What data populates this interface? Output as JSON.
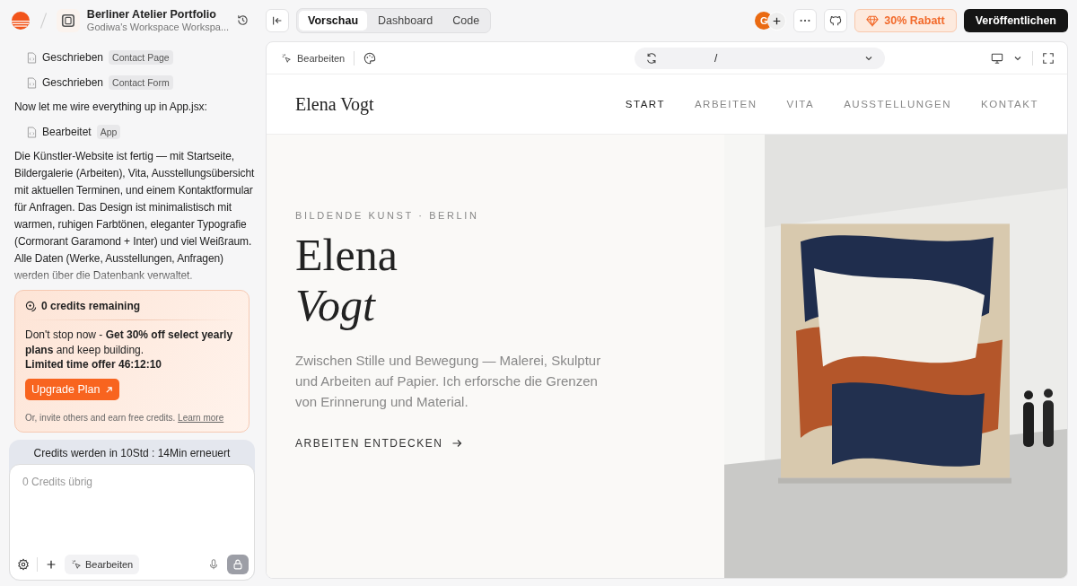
{
  "project": {
    "title": "Berliner Atelier Portfolio",
    "subtitle": "Godiwa's Workspace Workspa..."
  },
  "chat": [
    {
      "kind": "action",
      "verb": "Geschrieben",
      "tag": "Contact Page"
    },
    {
      "kind": "action",
      "verb": "Geschrieben",
      "tag": "Contact Form"
    },
    {
      "kind": "text",
      "text": "Now let me wire everything up in App.jsx:"
    },
    {
      "kind": "action",
      "verb": "Bearbeitet",
      "tag": "App"
    },
    {
      "kind": "text",
      "text": "Die Künstler-Website ist fertig — mit Startseite, Bildergalerie (Arbeiten), Vita, Ausstellungsübersicht mit aktuellen Terminen, und einem Kontaktformular für Anfragen. Das Design ist minimalistisch mit warmen, ruhigen Farbtönen, eleganter Typografie (Cormorant Garamond + Inter) und viel Weißraum. Alle Daten (Werke, Ausstellungen, Anfragen) werden über die Datenbank verwaltet."
    }
  ],
  "credits_card": {
    "title": "0 credits remaining",
    "message": "Don't stop now - **Get 30% off select yearly plans** and keep building.",
    "offer": "Limited time offer 46:12:10",
    "button": "Upgrade Plan",
    "footer": "Or, invite others and earn free credits.",
    "link": "Learn more"
  },
  "renewal": "Credits werden in 10Std : 14Min erneuert",
  "composer": {
    "placeholder": "0 Credits übrig",
    "mode": "Bearbeiten"
  },
  "tabs": [
    {
      "label": "Vorschau",
      "selected": true
    },
    {
      "label": "Dashboard",
      "selected": false
    },
    {
      "label": "Code",
      "selected": false
    }
  ],
  "avatar": "G",
  "discount": "30% Rabatt",
  "publish": "Veröffentlichen",
  "preview_toolbar": {
    "edit": "Bearbeiten",
    "path": "/"
  },
  "site": {
    "logo": "Elena Vogt",
    "nav": [
      {
        "label": "START",
        "selected": true
      },
      {
        "label": "ARBEITEN",
        "selected": false
      },
      {
        "label": "VITA",
        "selected": false
      },
      {
        "label": "AUSSTELLUNGEN",
        "selected": false
      },
      {
        "label": "KONTAKT",
        "selected": false
      }
    ],
    "eyebrow": "BILDENDE KUNST · BERLIN",
    "title_line1": "Elena",
    "title_line2": "Vogt",
    "intro": "Zwischen Stille und Bewegung — Malerei, Skulptur und Arbeiten auf Papier. Ich erforsche die Grenzen von Erinnerung und Material.",
    "cta": "ARBEITEN ENTDECKEN"
  }
}
